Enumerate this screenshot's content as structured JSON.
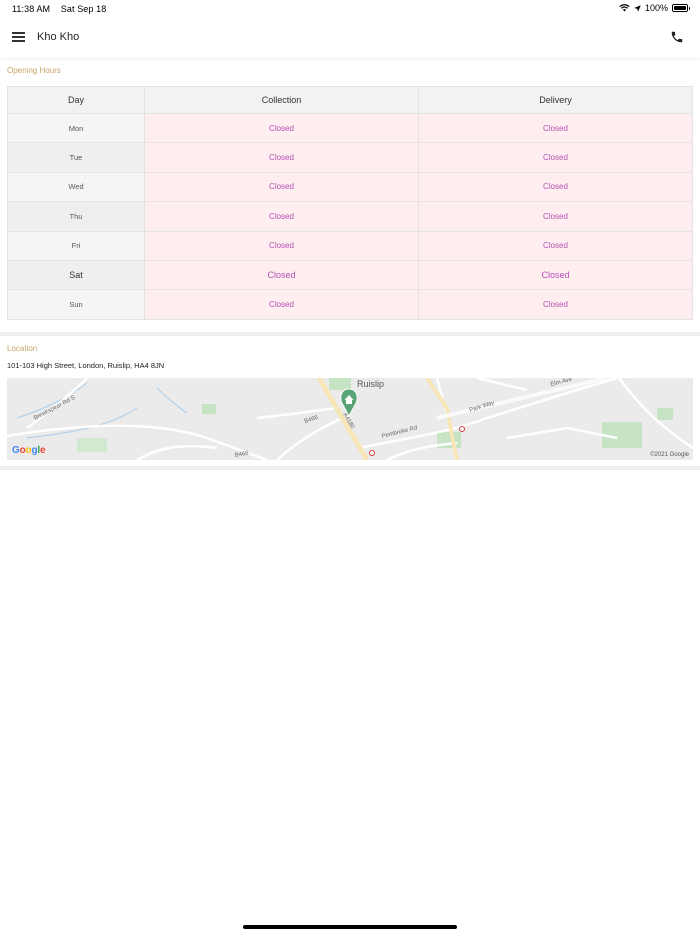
{
  "status_bar": {
    "time": "11:38 AM",
    "date": "Sat Sep 18",
    "battery": "100%",
    "battery_level": 1.0
  },
  "header": {
    "title": "Kho Kho"
  },
  "opening_hours": {
    "label": "Opening Hours",
    "columns": [
      "Day",
      "Collection",
      "Delivery"
    ],
    "rows": [
      {
        "day": "Mon",
        "collection": "Closed",
        "delivery": "Closed"
      },
      {
        "day": "Tue",
        "collection": "Closed",
        "delivery": "Closed"
      },
      {
        "day": "Wed",
        "collection": "Closed",
        "delivery": "Closed"
      },
      {
        "day": "Thu",
        "collection": "Closed",
        "delivery": "Closed"
      },
      {
        "day": "Fri",
        "collection": "Closed",
        "delivery": "Closed"
      },
      {
        "day": "Sat",
        "collection": "Closed",
        "delivery": "Closed"
      },
      {
        "day": "Sun",
        "collection": "Closed",
        "delivery": "Closed"
      }
    ]
  },
  "location": {
    "label": "Location",
    "address": "101-103 High Street, London, Ruislip, HA4 8JN",
    "map": {
      "place_label": "Ruislip",
      "road_labels": [
        "Breakspear Rd S",
        "B466",
        "B466",
        "A4180",
        "Pembroke Rd",
        "Park Way",
        "Elm Ave"
      ],
      "logo": "Google",
      "copyright": "©2021 Google",
      "marker_icon": "home-icon"
    }
  },
  "colors": {
    "accent_label": "#c8a46b",
    "closed_text": "#b34fb5",
    "closed_bg": "#ffeef0",
    "marker": "#5aa478"
  }
}
